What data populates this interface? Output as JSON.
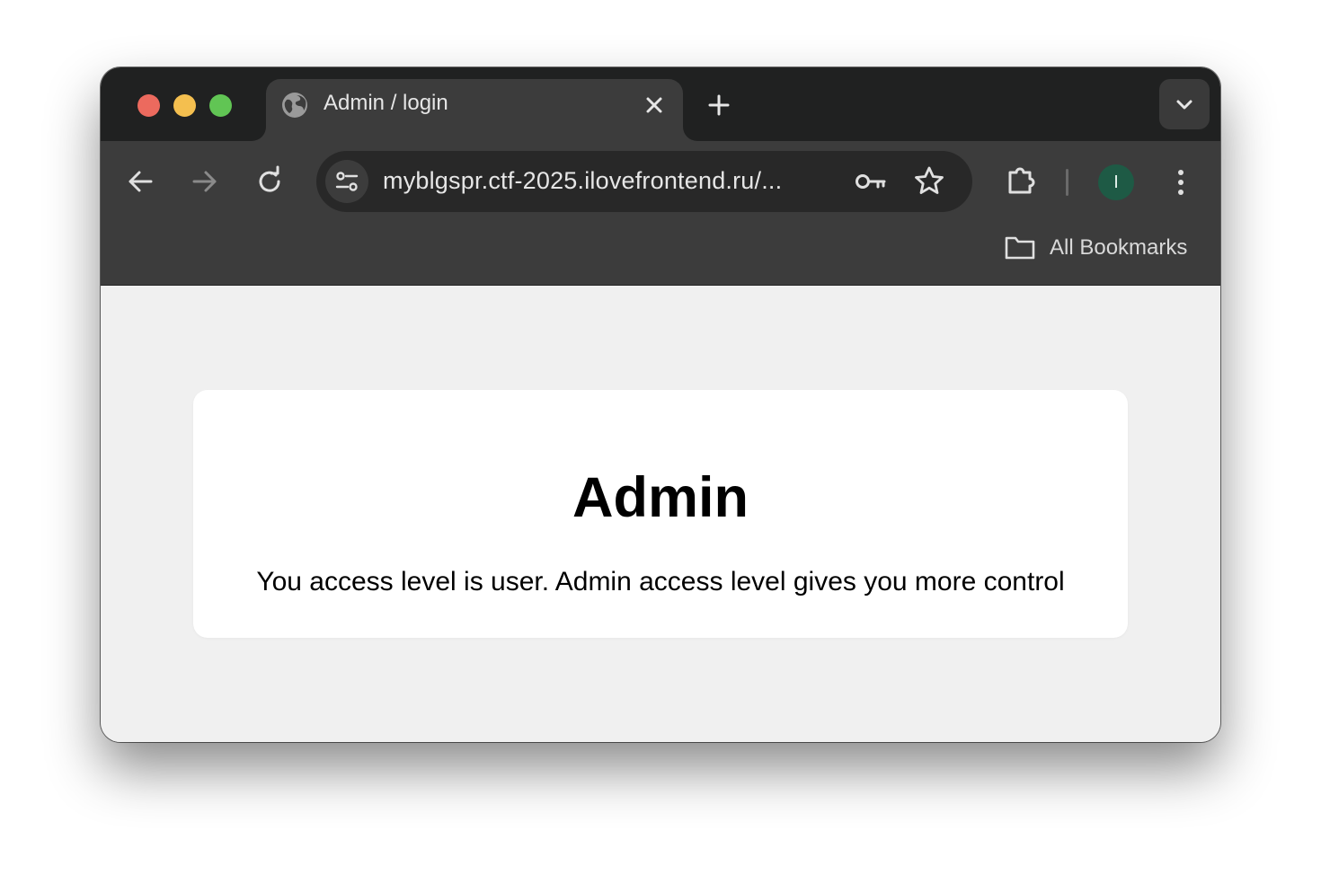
{
  "tab": {
    "title": "Admin / login",
    "favicon": "globe-icon"
  },
  "toolbar": {
    "url": "myblgspr.ctf-2025.ilovefrontend.ru/...",
    "profile_initial": "I",
    "profile_color": "#1e5a45"
  },
  "bookmarks": {
    "all_label": "All Bookmarks"
  },
  "page": {
    "heading": "Admin",
    "message": "You access level is user. Admin access level gives you more control"
  },
  "colors": {
    "close": "#ec6a5e",
    "minimize": "#f4bf4f",
    "maximize": "#61c554",
    "tabstrip": "#202121",
    "toolbar": "#3c3c3c",
    "page_bg": "#f0f0f0"
  }
}
